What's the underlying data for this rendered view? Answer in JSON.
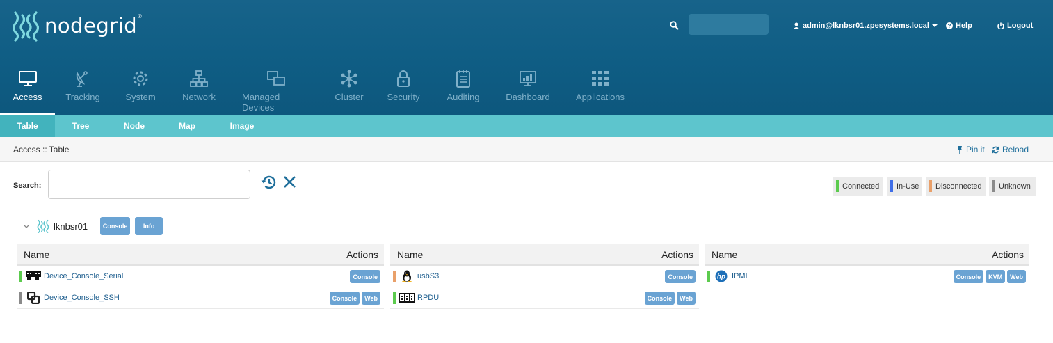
{
  "header": {
    "logo_text": "nodegrid",
    "logo_reg": "®",
    "search_placeholder": "",
    "user": "admin@lknbsr01.zpesystems.local",
    "help": "Help",
    "logout": "Logout"
  },
  "nav": [
    "Access",
    "Tracking",
    "System",
    "Network",
    "Managed Devices",
    "Cluster",
    "Security",
    "Auditing",
    "Dashboard",
    "Applications"
  ],
  "subnav": [
    "Table",
    "Tree",
    "Node",
    "Map",
    "Image"
  ],
  "breadcrumb": "Access :: Table",
  "actions": {
    "pin": "Pin it",
    "reload": "Reload"
  },
  "search": {
    "label": "Search:",
    "value": ""
  },
  "legend": [
    {
      "label": "Connected",
      "color": "#5ccb4e"
    },
    {
      "label": "In-Use",
      "color": "#3f6ee8"
    },
    {
      "label": "Disconnected",
      "color": "#e9a06a"
    },
    {
      "label": "Unknown",
      "color": "#8a8a8a"
    }
  ],
  "device": {
    "name": "lknbsr01",
    "console": "Console",
    "info": "Info"
  },
  "tables": [
    {
      "name_header": "Name",
      "actions_header": "Actions",
      "rows": [
        {
          "name": "Device_Console_Serial",
          "status_color": "#5ccb4e",
          "icon": "serial-port-icon",
          "actions": [
            "Console"
          ]
        },
        {
          "name": "Device_Console_SSH",
          "status_color": "#8a8a8a",
          "icon": "ssh-link-icon",
          "actions": [
            "Console",
            "Web"
          ]
        }
      ]
    },
    {
      "name_header": "Name",
      "actions_header": "Actions",
      "rows": [
        {
          "name": "usbS3",
          "status_color": "#e9a06a",
          "icon": "linux-tux-icon",
          "actions": [
            "Console"
          ]
        },
        {
          "name": "RPDU",
          "status_color": "#5ccb4e",
          "icon": "pdu-icon",
          "actions": [
            "Console",
            "Web"
          ]
        }
      ]
    },
    {
      "name_header": "Name",
      "actions_header": "Actions",
      "rows": [
        {
          "name": "IPMI",
          "status_color": "#5ccb4e",
          "icon": "hp-logo-icon",
          "actions": [
            "Console",
            "KVM",
            "Web"
          ]
        }
      ]
    }
  ]
}
